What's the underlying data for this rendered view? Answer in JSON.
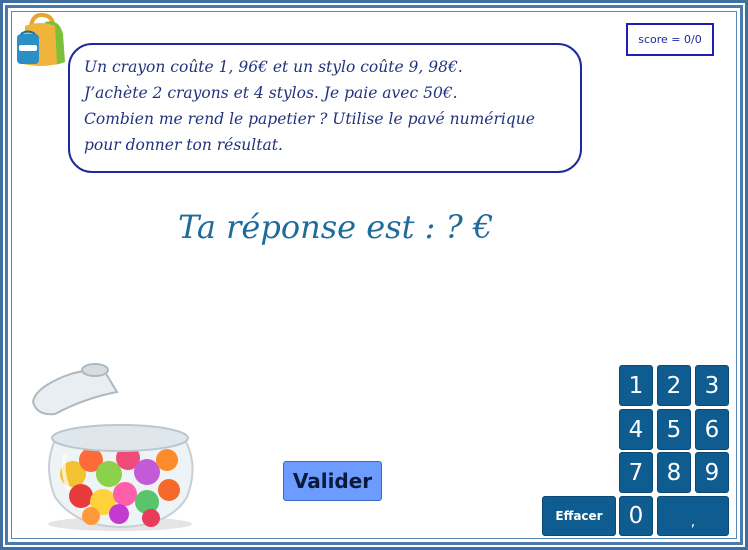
{
  "score": {
    "text": "score = 0/0"
  },
  "problem": {
    "lines": [
      "Un crayon coûte 1, 96€ et un stylo coûte 9, 98€.",
      "J’achète 2 crayons et 4 stylos. Je paie avec 50€.",
      "Combien me rend le papetier ? Utilise le pavé numérique",
      "pour donner ton résultat."
    ]
  },
  "answer": {
    "text": "Ta réponse est  : ? €"
  },
  "validate_label": "Valider",
  "keypad": {
    "keys": [
      "1",
      "2",
      "3",
      "4",
      "5",
      "6",
      "7",
      "8",
      "9",
      "0",
      ","
    ],
    "erase_label": "Effacer"
  },
  "colors": {
    "key_bg": "#0f5c90",
    "validate_bg": "#6c9cff",
    "frame": "#3f6fa0",
    "bubble_border": "#1d2a9c",
    "answer_text": "#1f6b9c"
  },
  "icons": [
    "backpack-icon",
    "candy-jar-image"
  ]
}
